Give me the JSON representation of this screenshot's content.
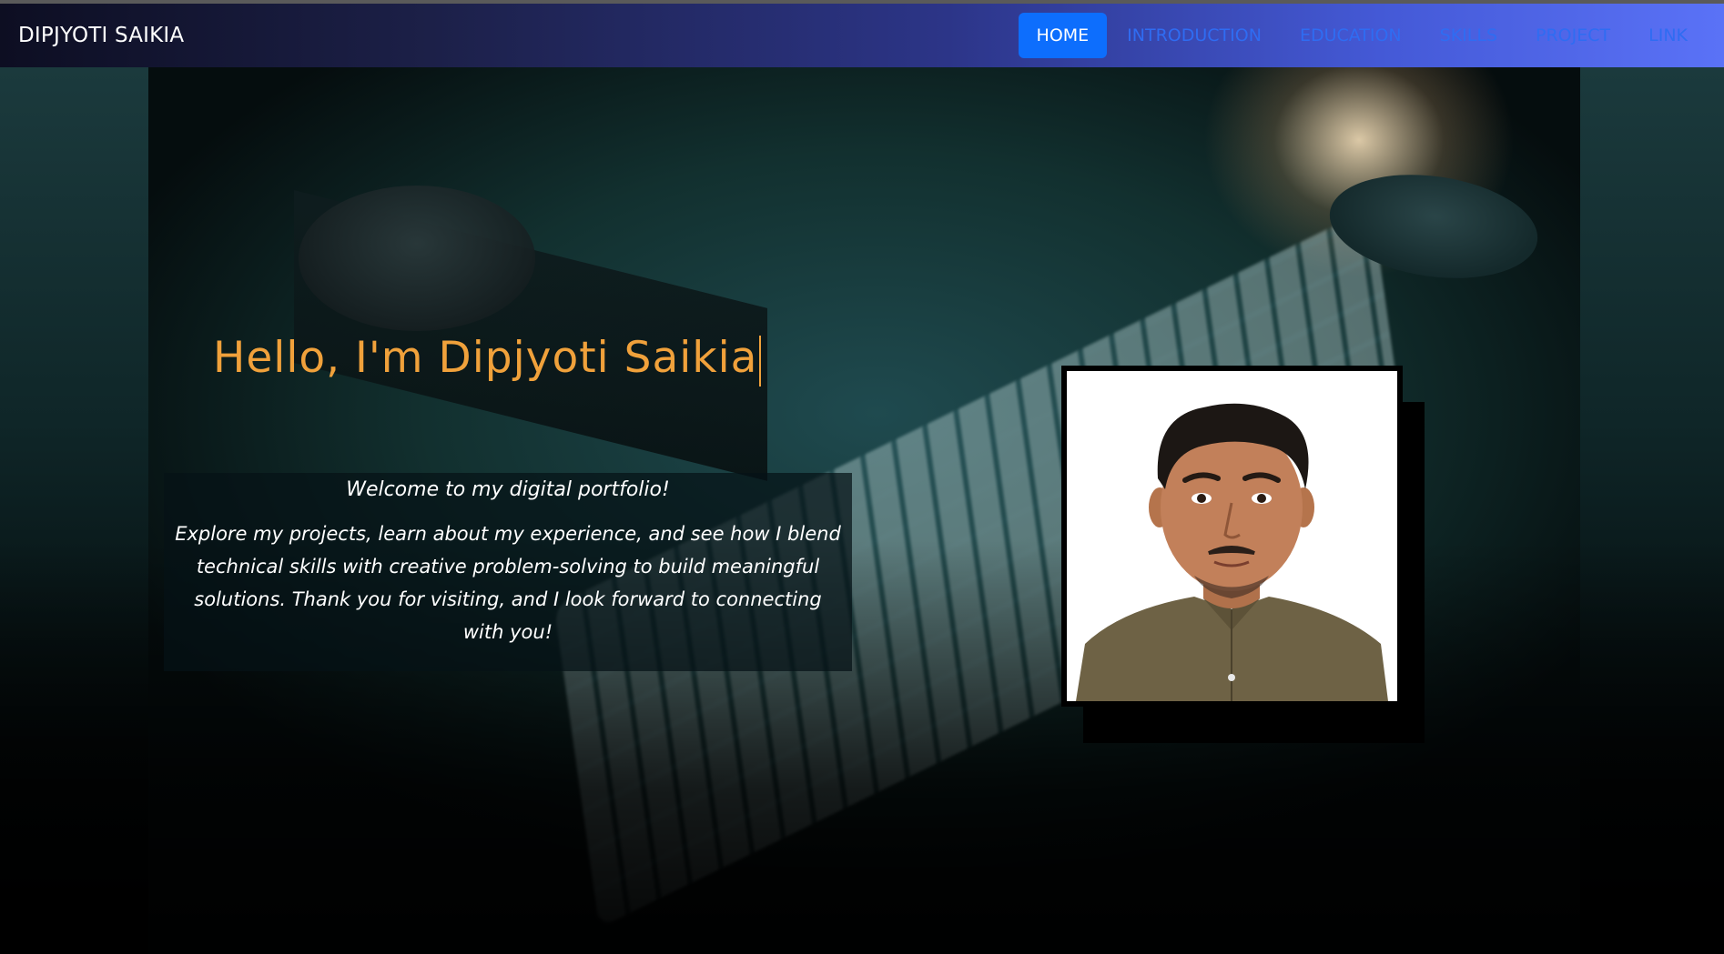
{
  "navbar": {
    "brand": "DIPJYOTI SAIKIA",
    "links": [
      {
        "label": "HOME",
        "active": true
      },
      {
        "label": "INTRODUCTION",
        "active": false
      },
      {
        "label": "EDUCATION",
        "active": false
      },
      {
        "label": "SKILLS",
        "active": false
      },
      {
        "label": "PROJECT",
        "active": false
      },
      {
        "label": "LINK",
        "active": false
      }
    ]
  },
  "hero": {
    "heading": "Hello, I'm Dipjyoti Saikia",
    "welcome": "Welcome to my digital portfolio!",
    "description": "Explore my projects, learn about my experience, and see how I blend technical skills with creative problem-solving to build meaningful solutions. Thank you for visiting, and I look forward to connecting with you!"
  },
  "colors": {
    "accent": "#f0a13b",
    "nav_active": "#0d6efd",
    "nav_link": "#2f6cf2"
  }
}
